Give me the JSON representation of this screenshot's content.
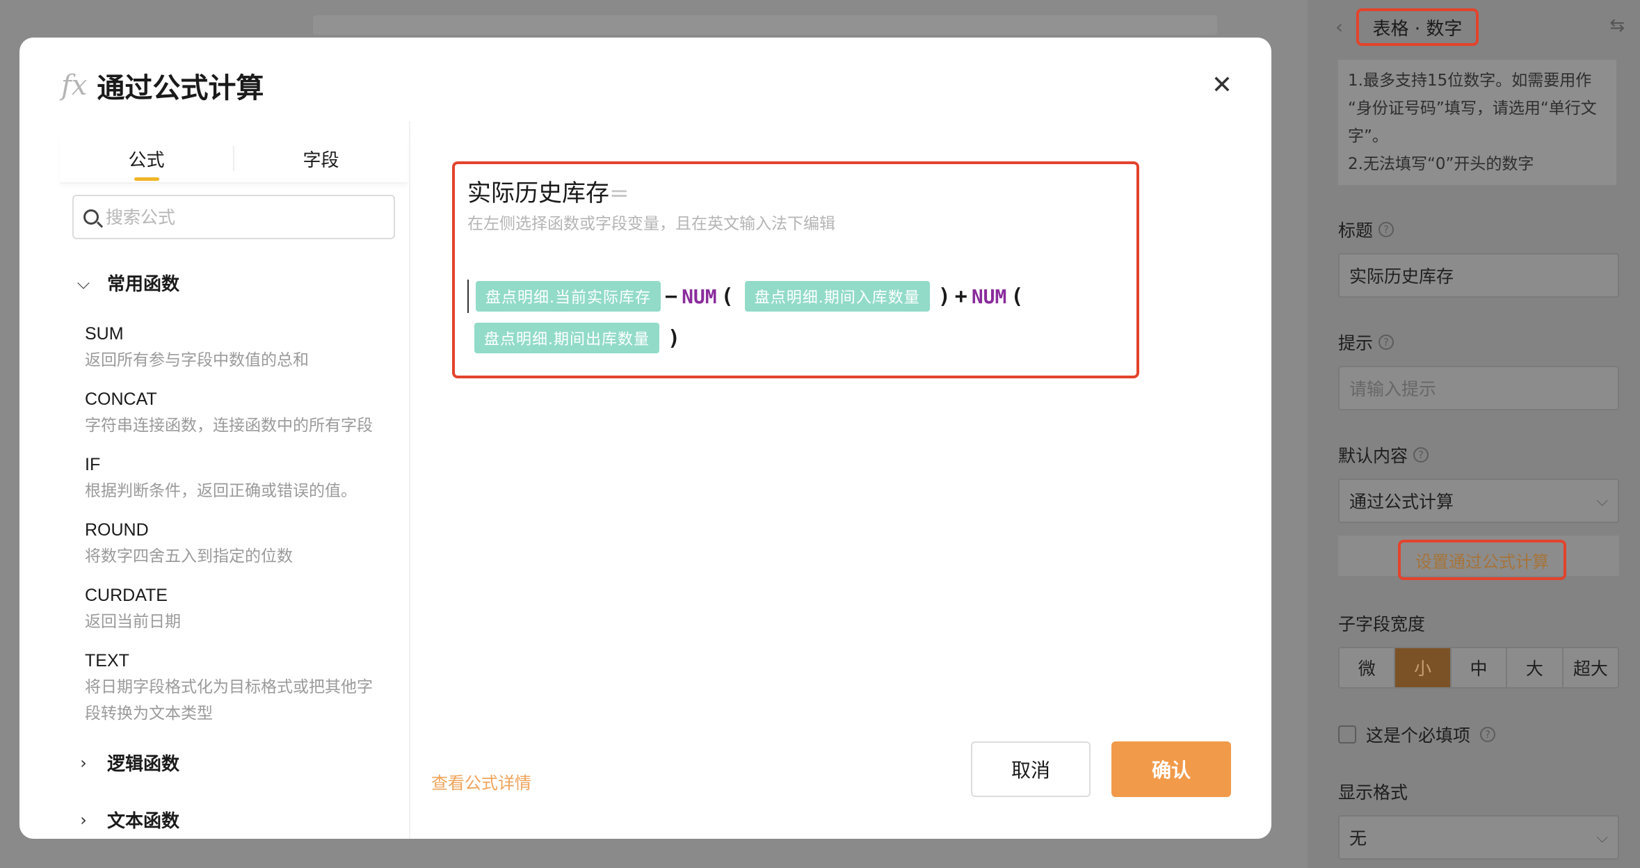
{
  "modal": {
    "title": "通过公式计算",
    "fx_icon": "fx",
    "close_icon": "✕",
    "tabs": [
      {
        "label": "公式",
        "active": true
      },
      {
        "label": "字段",
        "active": false
      }
    ],
    "search": {
      "placeholder": "搜索公式",
      "value": ""
    },
    "groups": {
      "common": {
        "label": "常用函数",
        "expanded": true
      },
      "logic": {
        "label": "逻辑函数",
        "expanded": false
      },
      "text": {
        "label": "文本函数",
        "expanded": false
      }
    },
    "functions": [
      {
        "name": "SUM",
        "desc": "返回所有参与字段中数值的总和"
      },
      {
        "name": "CONCAT",
        "desc": "字符串连接函数，连接函数中的所有字段"
      },
      {
        "name": "IF",
        "desc": "根据判断条件，返回正确或错误的值。"
      },
      {
        "name": "ROUND",
        "desc": "将数字四舍五入到指定的位数"
      },
      {
        "name": "CURDATE",
        "desc": "返回当前日期"
      },
      {
        "name": "TEXT",
        "desc": "将日期字段格式化为目标格式或把其他字段转换为文本类型"
      }
    ],
    "editor": {
      "title": "实际历史库存",
      "equals": "=",
      "hint": "在左侧选择函数或字段变量，且在英文输入法下编辑",
      "tokens": {
        "field1": "盘点明细.当前实际库存",
        "minus": "−",
        "fn1": "NUM",
        "lparen1": "(",
        "field2": "盘点明细.期间入库数量",
        "rparen1": ")",
        "plus": "+",
        "fn2": "NUM",
        "lparen2": "(",
        "field3": "盘点明细.期间出库数量",
        "rparen2": ")"
      }
    },
    "more_link": "查看公式详情",
    "cancel_label": "取消",
    "confirm_label": "确认"
  },
  "panel": {
    "type_title": "表格 · 数字",
    "notice_lines": [
      "1.最多支持15位数字。如需要用作",
      "“身份证号码”填写，请选用“单行文",
      "字”。",
      "2.无法填写“0”开头的数字"
    ],
    "title_label": "标题",
    "title_value": "实际历史库存",
    "hint_label": "提示",
    "hint_placeholder": "请输入提示",
    "default_label": "默认内容",
    "default_value": "通过公式计算",
    "set_formula_label": "设置通过公式计算",
    "width_label": "子字段宽度",
    "width_options": [
      "微",
      "小",
      "中",
      "大",
      "超大"
    ],
    "width_selected": "小",
    "required_label": "这是个必填项",
    "format_label": "显示格式",
    "format_value": "无"
  }
}
